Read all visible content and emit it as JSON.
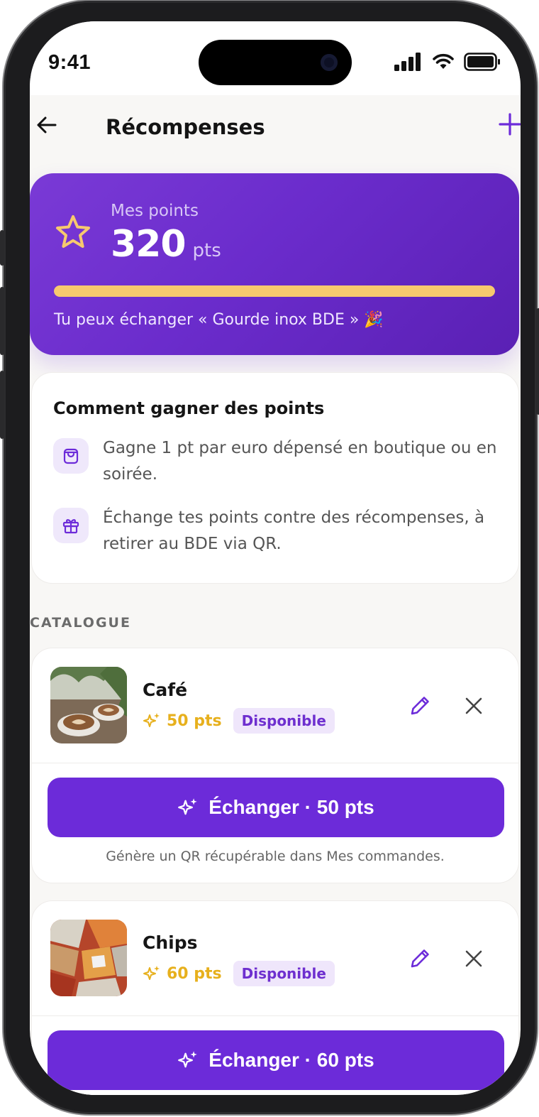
{
  "status_bar": {
    "time": "9:41"
  },
  "header": {
    "title": "Récompenses"
  },
  "points": {
    "label": "Mes points",
    "value": "320",
    "unit": "pts",
    "progress": 1.0,
    "message": "Tu peux échanger « Gourde inox BDE » 🎉"
  },
  "earn": {
    "title": "Comment gagner des points",
    "items": [
      {
        "icon": "shopping-bag-icon",
        "text": "Gagne 1 pt par euro dépensé en boutique ou en soirée."
      },
      {
        "icon": "gift-icon",
        "text": "Échange tes points contre des récompenses, à retirer au BDE via QR."
      }
    ]
  },
  "catalogue": {
    "section_label": "CATALOGUE",
    "items": [
      {
        "name": "Café",
        "points": "50 pts",
        "badge": "Disponible",
        "cta": "Échanger · 50 pts",
        "note": "Génère un QR récupérable dans Mes commandes."
      },
      {
        "name": "Chips",
        "points": "60 pts",
        "badge": "Disponible",
        "cta": "Échanger · 60 pts"
      }
    ]
  },
  "colors": {
    "accent": "#6c2bd9",
    "gold": "#e7b01d",
    "progress": "#f7c96e"
  }
}
